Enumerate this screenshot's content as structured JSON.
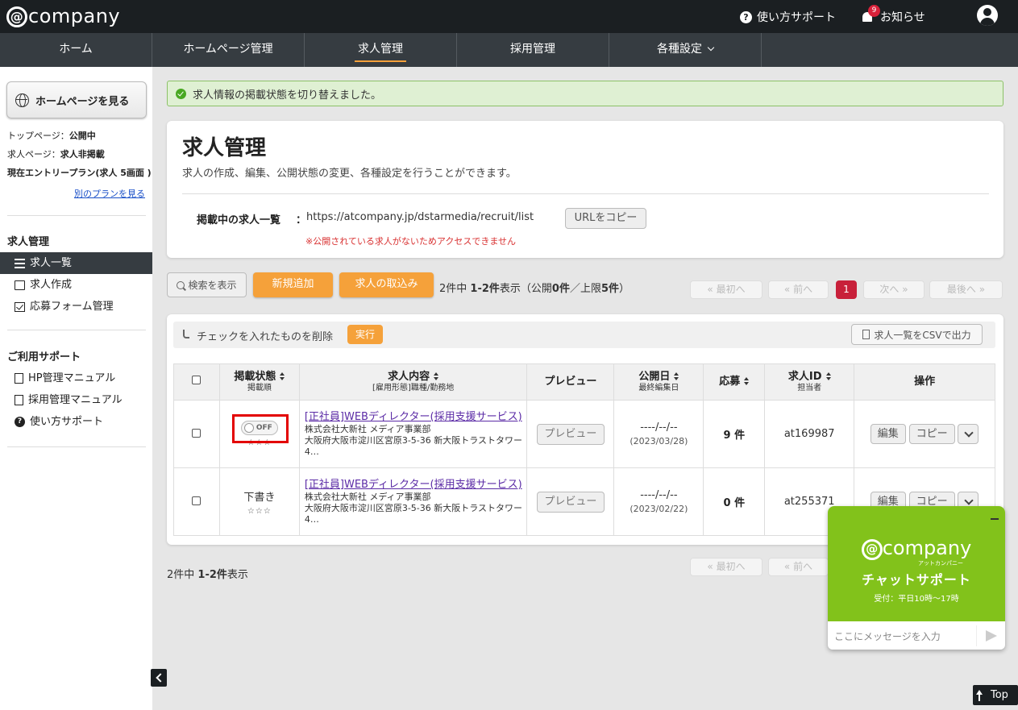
{
  "header": {
    "logo": "company",
    "logo_at": "@",
    "support": "使い方サポート",
    "news": "お知らせ",
    "news_badge": "9"
  },
  "nav": {
    "items": [
      {
        "label": "ホーム"
      },
      {
        "label": "ホームページ管理"
      },
      {
        "label": "求人管理",
        "active": true
      },
      {
        "label": "採用管理"
      },
      {
        "label": "各種設定"
      }
    ]
  },
  "sidebar": {
    "hp_button": "ホームページを見る",
    "top_page_label": "トップページ：",
    "top_page_value": "公開中",
    "job_page_label": "求人ページ：",
    "job_page_value": "求人非掲載",
    "plan": "現在エントリープラン(求人 5画面 )",
    "plan_link": "別のプランを見る",
    "section1": "求人管理",
    "menu1": [
      "求人一覧",
      "求人作成",
      "応募フォーム管理"
    ],
    "section2": "ご利用サポート",
    "menu2": [
      "HP管理マニュアル",
      "採用管理マニュアル",
      "使い方サポート"
    ]
  },
  "alert": {
    "message": "求人情報の掲載状態を切り替えました。"
  },
  "page": {
    "title": "求人管理",
    "description": "求人の作成、編集、公開状態の変更、各種設定を行うことができます。",
    "url_label": "掲載中の求人一覧",
    "url_colon": "：",
    "url_value": "https://atcompany.jp/dstarmedia/recruit/list",
    "url_copy": "URLをコピー",
    "url_warning": "※公開されている求人がないためアクセスできません"
  },
  "toolbar": {
    "search": "検索を表示",
    "new": "新規追加",
    "import": "求人の取込み",
    "count_prefix": "2件中 ",
    "count_range": "1-2件",
    "count_suffix": "表示（公開",
    "count_public": "0件",
    "count_mid": "／上限",
    "count_limit": "5件",
    "count_end": "）"
  },
  "pagination": {
    "first": "« 最初へ",
    "prev": "« 前へ",
    "current": "1",
    "next": "次へ »",
    "last": "最後へ »"
  },
  "bulk": {
    "label": "チェックを入れたものを削除",
    "exec": "実行",
    "csv": "求人一覧をCSVで出力"
  },
  "table": {
    "headers": {
      "status": "掲載状態",
      "status_sub": "掲載順",
      "content": "求人内容",
      "content_sub": "[雇用形態]職種/勤務地",
      "preview": "プレビュー",
      "date": "公開日",
      "date_sub": "最終編集日",
      "apps": "応募",
      "id": "求人ID",
      "id_sub": "担当者",
      "ops": "操作"
    },
    "rows": [
      {
        "status": "OFF",
        "stars": "☆☆☆",
        "title": "[正社員]WEBディレクター(採用支援サービス)",
        "company": "株式会社大新社 メディア事業部",
        "address": "大阪府大阪市淀川区宮原3-5-36 新大阪トラストタワー4…",
        "preview": "プレビュー",
        "published": "----/--/--",
        "edited": "(2023/03/28)",
        "apps": "9 件",
        "id": "at169987",
        "edit": "編集",
        "copy": "コピー"
      },
      {
        "status": "下書き",
        "stars": "☆☆☆",
        "title": "[正社員]WEBディレクター(採用支援サービス)",
        "company": "株式会社大新社 メディア事業部",
        "address": "大阪府大阪市淀川区宮原3-5-36 新大阪トラストタワー4…",
        "preview": "プレビュー",
        "published": "----/--/--",
        "edited": "(2023/02/22)",
        "apps": "0 件",
        "id": "at255371",
        "edit": "編集",
        "copy": "コピー"
      }
    ]
  },
  "footer_count": {
    "prefix": "2件中 ",
    "range": "1-2件",
    "suffix": "表示"
  },
  "chat": {
    "logo_at": "@",
    "logo": "company",
    "kana": "アットカンパニー",
    "title": "チャットサポート",
    "hours": "受付：平日10時〜17時",
    "placeholder": "ここにメッセージを入力"
  },
  "top_button": "Top",
  "colors": {
    "accent": "#f5a13a",
    "nav_bg": "#363c41",
    "topbar_bg": "#1b1f22",
    "chat_green": "#82c21b",
    "page_current": "#c8203a"
  }
}
